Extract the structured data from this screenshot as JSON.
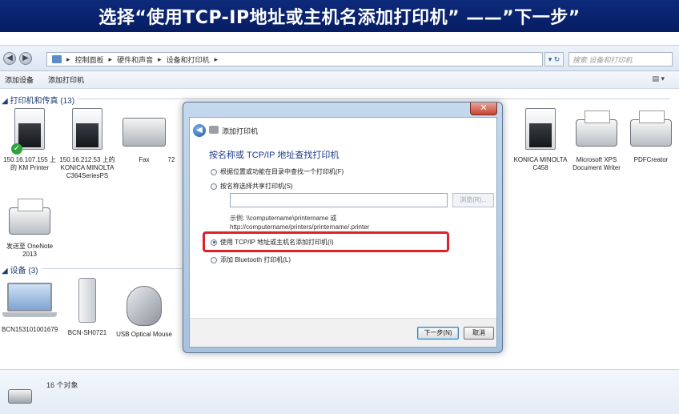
{
  "banner": {
    "title": "选择“使用TCP-IP地址或主机名添加打印机” ——”下一步”"
  },
  "address_bar": {
    "back": "◀",
    "forward": "▶",
    "crumbs": [
      "控制面板",
      "硬件和声音",
      "设备和打印机"
    ],
    "separator": "▸",
    "refresh": "▾ ↻",
    "search_placeholder": "搜索 设备和打印机"
  },
  "toolbar": {
    "add_device": "添加设备",
    "add_printer": "添加打印机",
    "view": "▤ ▾"
  },
  "printers_group": {
    "header": "◢ 打印机和传真 (13)",
    "items": [
      {
        "label": "150.16.107.155 上的 KM Printer"
      },
      {
        "label": "150.16.212.53 上的 KONICA MINOLTA C364SeriesPS"
      },
      {
        "label": "Fax"
      },
      {
        "label": "72"
      },
      {
        "label": "KONICA MINOLTA C458"
      },
      {
        "label": "Microsoft XPS Document Writer"
      },
      {
        "label": "PDFCreator"
      },
      {
        "label": "发送至 OneNote 2013"
      }
    ]
  },
  "devices_group": {
    "header": "◢ 设备 (3)",
    "items": [
      {
        "label": "BCN153101001679"
      },
      {
        "label": "BCN-SH0721"
      },
      {
        "label": "USB Optical Mouse"
      }
    ]
  },
  "status": {
    "count": "16 个对象"
  },
  "dialog": {
    "close": "✕",
    "title": "添加打印机",
    "heading": "按名称或 TCP/IP 地址查找打印机",
    "option1": "根据位置或功能在目录中查找一个打印机(F)",
    "option2": "按名称选择共享打印机(S)",
    "browse": "浏览(R)...",
    "example_line1": "示例: \\\\computername\\printername 或",
    "example_line2": "http://computername/printers/printername/.printer",
    "option3": "使用 TCP/IP 地址或主机名添加打印机(I)",
    "option4": "添加 Bluetooth 打印机(L)",
    "next": "下一步(N)",
    "cancel": "取消"
  },
  "colors": {
    "banner_bg": "#0d2a7a",
    "highlight": "#e0202a",
    "link_blue": "#1e3b8a"
  }
}
